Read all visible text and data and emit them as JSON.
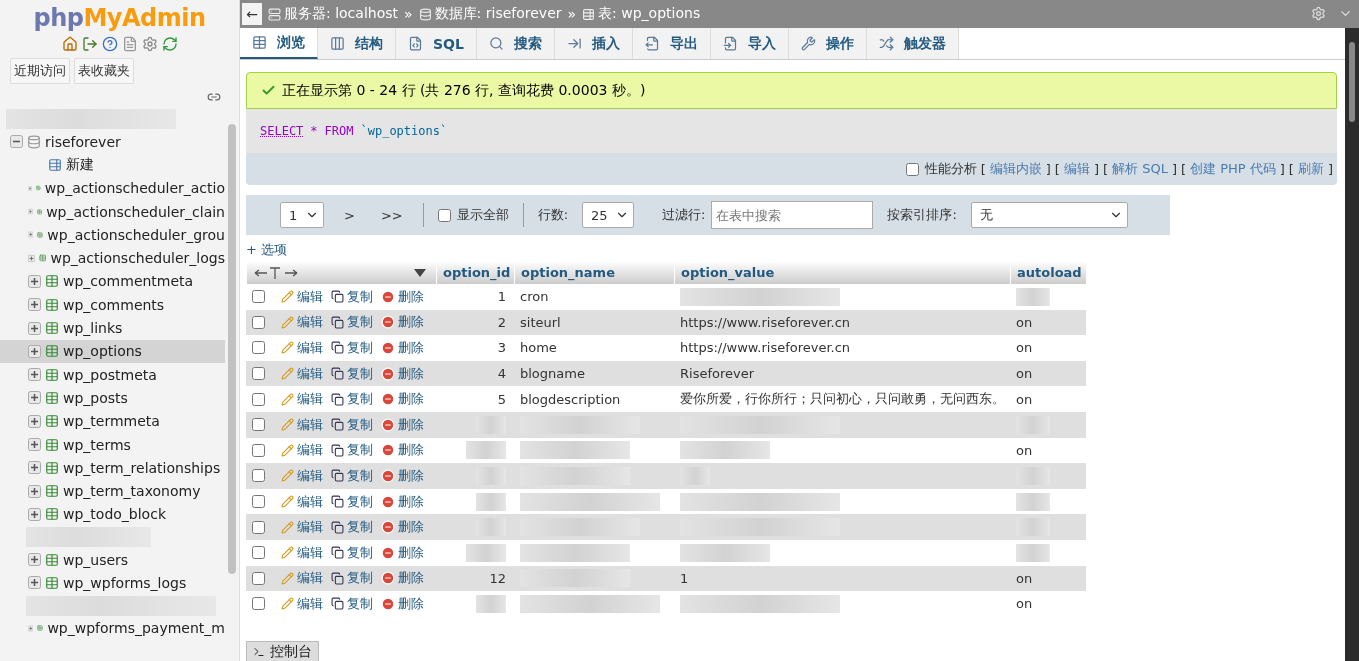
{
  "sidebar": {
    "logo_left": "php",
    "logo_right": "MyAdmin",
    "buttons": [
      "近期访问",
      "表收藏夹"
    ],
    "tree": {
      "label": "riseforever",
      "expanded": true,
      "children": [
        {
          "kind": "new",
          "label": "新建",
          "selected": false
        },
        {
          "kind": "table",
          "label": "wp_actionscheduler_actio",
          "selected": false
        },
        {
          "kind": "table",
          "label": "wp_actionscheduler_clain",
          "selected": false
        },
        {
          "kind": "table",
          "label": "wp_actionscheduler_grou",
          "selected": false
        },
        {
          "kind": "table",
          "label": "wp_actionscheduler_logs",
          "selected": false
        },
        {
          "kind": "table",
          "label": "wp_commentmeta",
          "selected": false
        },
        {
          "kind": "table",
          "label": "wp_comments",
          "selected": false
        },
        {
          "kind": "table",
          "label": "wp_links",
          "selected": false
        },
        {
          "kind": "table",
          "label": "wp_options",
          "selected": true
        },
        {
          "kind": "table",
          "label": "wp_postmeta",
          "selected": false
        },
        {
          "kind": "table",
          "label": "wp_posts",
          "selected": false
        },
        {
          "kind": "table",
          "label": "wp_termmeta",
          "selected": false
        },
        {
          "kind": "table",
          "label": "wp_terms",
          "selected": false
        },
        {
          "kind": "table",
          "label": "wp_term_relationships",
          "selected": false
        },
        {
          "kind": "table",
          "label": "wp_term_taxonomy",
          "selected": false
        },
        {
          "kind": "table",
          "label": "wp_todo_block",
          "selected": false
        },
        {
          "kind": "blurred"
        },
        {
          "kind": "table",
          "label": "wp_users",
          "selected": false
        },
        {
          "kind": "table",
          "label": "wp_wpforms_logs",
          "selected": false
        },
        {
          "kind": "blurred"
        },
        {
          "kind": "table",
          "label": "wp_wpforms_payment_m",
          "selected": false
        }
      ]
    }
  },
  "breadcrumb": {
    "back": "←",
    "items": [
      {
        "kind": "server",
        "label": "服务器: localhost"
      },
      {
        "kind": "database",
        "label": "数据库: riseforever"
      },
      {
        "kind": "table",
        "label": "表: wp_options"
      }
    ],
    "separators": [
      "»",
      "»"
    ]
  },
  "tabs": [
    {
      "kind": "browse",
      "label": "浏览",
      "selected": true
    },
    {
      "kind": "structure",
      "label": "结构",
      "selected": false
    },
    {
      "kind": "sql",
      "label": "SQL",
      "selected": false
    },
    {
      "kind": "search",
      "label": "搜索",
      "selected": false
    },
    {
      "kind": "insert",
      "label": "插入",
      "selected": false
    },
    {
      "kind": "export",
      "label": "导出",
      "selected": false
    },
    {
      "kind": "import",
      "label": "导入",
      "selected": false
    },
    {
      "kind": "operations",
      "label": "操作",
      "selected": false
    },
    {
      "kind": "triggers",
      "label": "触发器",
      "selected": false
    }
  ],
  "notice": "正在显示第 0 - 24 行 (共 276 行, 查询花费 0.0003 秒。)",
  "sql": {
    "keyword1": "SELECT",
    "star": "*",
    "keyword2": "FROM",
    "table": "`wp_options`"
  },
  "query_tools": {
    "profiling": {
      "label": "性能分析",
      "checked": false
    },
    "links": [
      {
        "open": "[",
        "label": "编辑内嵌",
        "close": "]"
      },
      {
        "open": "[",
        "label": "编辑",
        "close": "]"
      },
      {
        "open": "[",
        "label": "解析 SQL",
        "close": "]"
      },
      {
        "open": "[",
        "label": "创建 PHP 代码",
        "close": "]"
      },
      {
        "open": "[",
        "label": "刷新",
        "close": "]"
      }
    ]
  },
  "navigation": {
    "page": "1",
    "next": ">",
    "last": ">>",
    "show_all": {
      "label": "显示全部",
      "checked": false
    },
    "rows_label": "行数:",
    "rows": "25",
    "filter_label": "过滤行:",
    "filter_placeholder": "在表中搜索",
    "sort_label": "按索引排序:",
    "sort": "无"
  },
  "options_link": "+ 选项",
  "table": {
    "columns": [
      "option_id",
      "option_name",
      "option_value",
      "autoload"
    ],
    "rows": [
      {
        "checked": false,
        "actions": [
          "编辑",
          "复制",
          "删除"
        ],
        "cells": [
          {
            "text": "1"
          },
          {
            "text": "cron"
          },
          {
            "kind": "blurred"
          },
          {
            "kind": "blurred"
          }
        ]
      },
      {
        "checked": false,
        "actions": [
          "编辑",
          "复制",
          "删除"
        ],
        "cells": [
          {
            "text": "2"
          },
          {
            "text": "siteurl"
          },
          {
            "text": "https://www.riseforever.cn"
          },
          {
            "text": "on"
          }
        ]
      },
      {
        "checked": false,
        "actions": [
          "编辑",
          "复制",
          "删除"
        ],
        "cells": [
          {
            "text": "3"
          },
          {
            "text": "home"
          },
          {
            "text": "https://www.riseforever.cn"
          },
          {
            "text": "on"
          }
        ]
      },
      {
        "checked": false,
        "actions": [
          "编辑",
          "复制",
          "删除"
        ],
        "cells": [
          {
            "text": "4"
          },
          {
            "text": "blogname"
          },
          {
            "text": "Riseforever"
          },
          {
            "text": "on"
          }
        ]
      },
      {
        "checked": false,
        "actions": [
          "编辑",
          "复制",
          "删除"
        ],
        "cells": [
          {
            "text": "5"
          },
          {
            "text": "blogdescription"
          },
          {
            "text": "爱你所爱，行你所行；只问初心，只问敢勇，无问西东。"
          },
          {
            "text": "on"
          }
        ]
      },
      {
        "checked": false,
        "actions": [
          "编辑",
          "复制",
          "删除"
        ],
        "cells": [
          {
            "kind": "blurred"
          },
          {
            "kind": "blurred"
          },
          {
            "kind": "blurred"
          },
          {
            "kind": "blurred"
          }
        ]
      },
      {
        "checked": false,
        "actions": [
          "编辑",
          "复制",
          "删除"
        ],
        "cells": [
          {
            "kind": "blurred"
          },
          {
            "kind": "blurred"
          },
          {
            "kind": "blurred"
          },
          {
            "text": "on"
          }
        ]
      },
      {
        "checked": false,
        "actions": [
          "编辑",
          "复制",
          "删除"
        ],
        "cells": [
          {
            "kind": "blurred"
          },
          {
            "kind": "blurred"
          },
          {
            "kind": "blurred"
          },
          {
            "kind": "blurred"
          }
        ]
      },
      {
        "checked": false,
        "actions": [
          "编辑",
          "复制",
          "删除"
        ],
        "cells": [
          {
            "kind": "blurred"
          },
          {
            "kind": "blurred"
          },
          {
            "kind": "blurred"
          },
          {
            "kind": "blurred"
          }
        ]
      },
      {
        "checked": false,
        "actions": [
          "编辑",
          "复制",
          "删除"
        ],
        "cells": [
          {
            "kind": "blurred"
          },
          {
            "kind": "blurred"
          },
          {
            "kind": "blurred"
          },
          {
            "kind": "blurred"
          }
        ]
      },
      {
        "checked": false,
        "actions": [
          "编辑",
          "复制",
          "删除"
        ],
        "cells": [
          {
            "kind": "blurred"
          },
          {
            "kind": "blurred"
          },
          {
            "kind": "blurred"
          },
          {
            "kind": "blurred"
          }
        ]
      },
      {
        "checked": false,
        "actions": [
          "编辑",
          "复制",
          "删除"
        ],
        "cells": [
          {
            "text": "12"
          },
          {
            "kind": "blurred"
          },
          {
            "text": "1"
          },
          {
            "text": "on"
          }
        ]
      },
      {
        "checked": false,
        "actions": [
          "编辑",
          "复制",
          "删除"
        ],
        "cells": [
          {
            "kind": "blurred"
          },
          {
            "kind": "blurred"
          },
          {
            "kind": "blurred"
          },
          {
            "text": "on"
          }
        ]
      }
    ]
  },
  "console": "控制台"
}
